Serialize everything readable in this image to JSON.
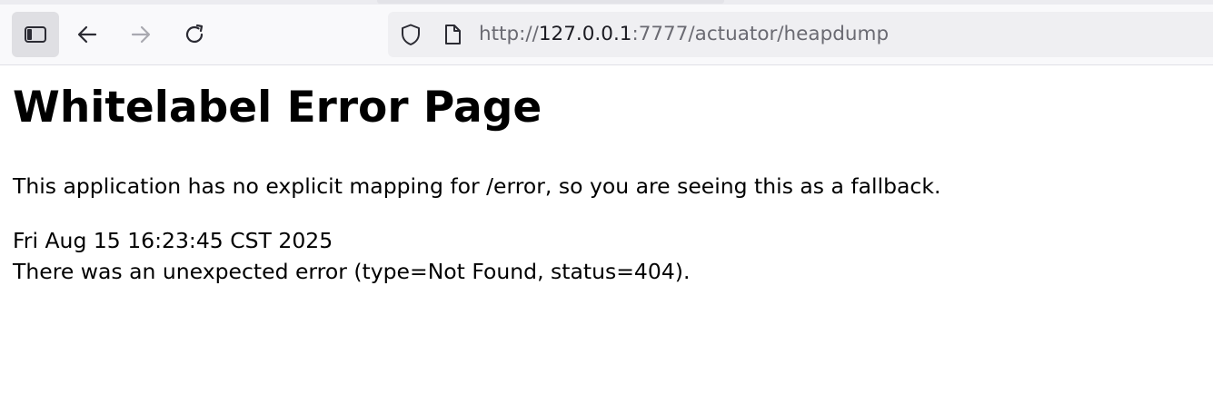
{
  "browser": {
    "url_scheme": "http://",
    "url_host": "127.0.0.1",
    "url_rest": ":7777/actuator/heapdump",
    "icons": {
      "sidebar": "sidebar-toggle-icon",
      "back": "arrow-left-icon",
      "forward": "arrow-right-icon",
      "reload": "reload-icon",
      "shield": "shield-icon",
      "page": "page-icon"
    }
  },
  "page": {
    "heading": "Whitelabel Error Page",
    "explanation": "This application has no explicit mapping for /error, so you are seeing this as a fallback.",
    "timestamp": "Fri Aug 15 16:23:45 CST 2025",
    "error_message": "There was an unexpected error (type=Not Found, status=404)."
  }
}
